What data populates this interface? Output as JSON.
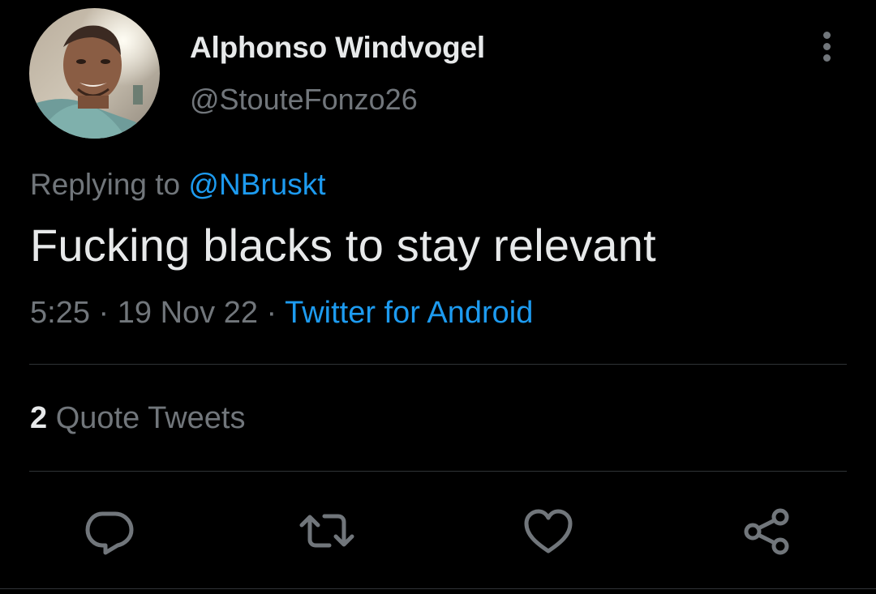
{
  "author": {
    "display_name": "Alphonso Windvogel",
    "handle": "@StouteFonzo26"
  },
  "reply": {
    "prefix": "Replying to ",
    "mention": "@NBruskt"
  },
  "tweet": {
    "text": "Fucking blacks to stay relevant",
    "time": "5:25",
    "separator1": " · ",
    "date": "19 Nov 22",
    "separator2": " · ",
    "source": "Twitter for Android"
  },
  "stats": {
    "quote_count": "2",
    "quote_label": " Quote Tweets"
  },
  "actions": {
    "reply_icon": "reply-icon",
    "retweet_icon": "retweet-icon",
    "like_icon": "heart-icon",
    "share_icon": "share-icon"
  },
  "colors": {
    "background": "#000000",
    "primary_text": "#e7e9ea",
    "secondary_text": "#71767b",
    "accent": "#1d9bf0",
    "divider": "#2f3336"
  }
}
